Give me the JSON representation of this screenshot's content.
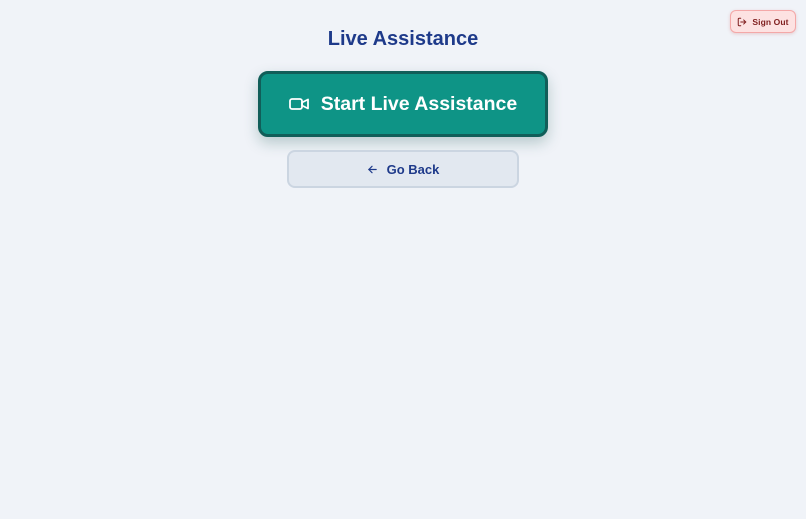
{
  "header": {
    "title": "Live Assistance",
    "sign_out": {
      "label": "Sign Out",
      "icon": "log-out-icon"
    }
  },
  "main": {
    "start_button": {
      "label": "Start Live Assistance",
      "icon": "video-camera-icon"
    },
    "back_button": {
      "label": "Go Back",
      "icon": "arrow-left-icon"
    }
  },
  "colors": {
    "background": "#f0f3f8",
    "title": "#1e3a8a",
    "primary": "#0e9486",
    "primary_border": "#115e59",
    "danger_bg": "#fde2e2",
    "danger_text": "#7f1d1d",
    "secondary_bg": "#e2e8f0"
  }
}
